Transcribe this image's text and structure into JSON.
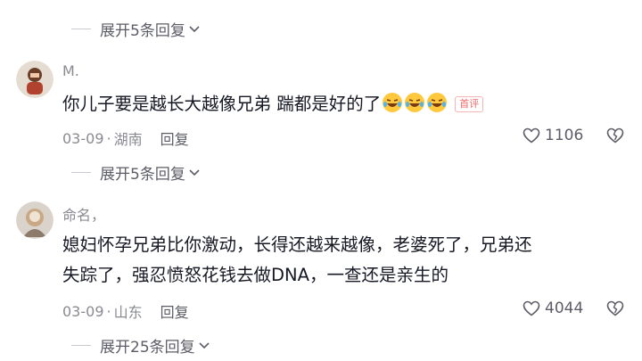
{
  "top_partial": {
    "expand_label": "展开5条回复"
  },
  "comments": [
    {
      "username": "M.",
      "content": "你儿子要是越长大越像兄弟  踹都是好的了",
      "emoji_count": 3,
      "badge": "首评",
      "date": "03-09",
      "location": "湖南",
      "reply_label": "回复",
      "likes": "1106",
      "expand_label": "展开5条回复"
    },
    {
      "username": "命名，",
      "content_line1": "媳妇怀孕兄弟比你激动，长得还越来越像，老婆死了，兄弟还",
      "content_line2": "失踪了，强忍愤怒花钱去做DNA，一查还是亲生的",
      "date": "03-09",
      "location": "山东",
      "reply_label": "回复",
      "likes": "4044",
      "expand_label": "展开25条回复"
    }
  ],
  "separator": "·",
  "colors": {
    "text": "#161823",
    "secondary": "#8a8b91",
    "badge": "#f06a6a"
  }
}
